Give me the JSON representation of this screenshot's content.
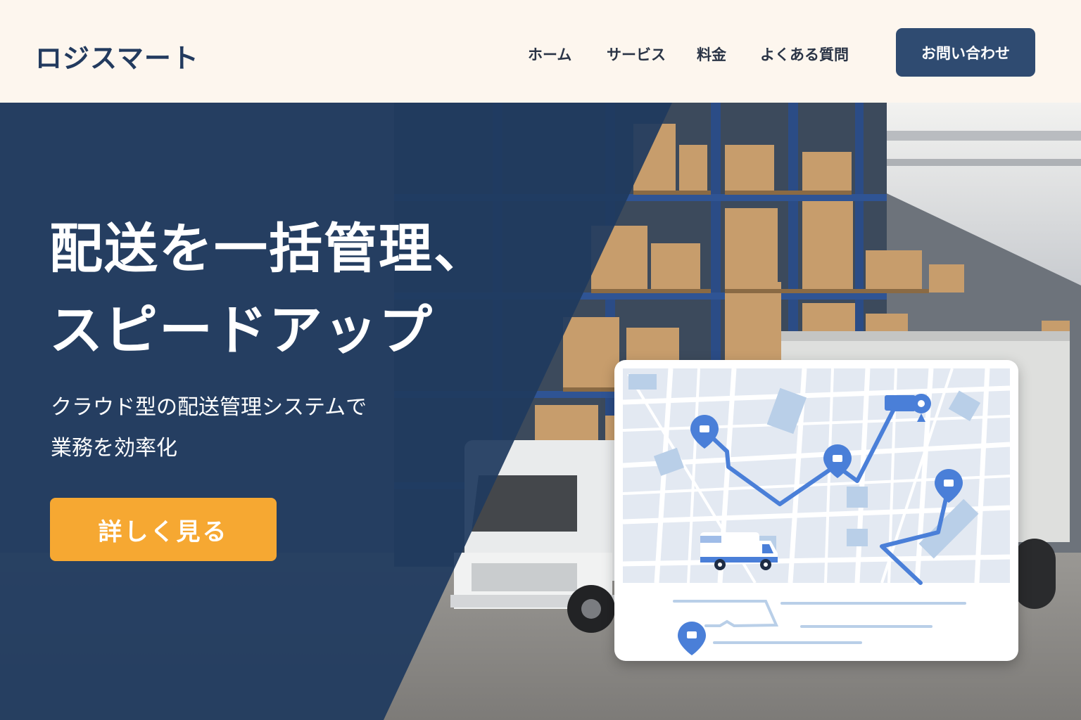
{
  "header": {
    "logo": "ロジスマート",
    "nav": [
      {
        "label": "ホーム"
      },
      {
        "label": "サービス"
      },
      {
        "label": "料金"
      },
      {
        "label": "よくある質問"
      }
    ],
    "contact_label": "お問い合わせ"
  },
  "hero": {
    "headline_line1": "配送を一括管理、",
    "headline_line2": "スピードアップ",
    "sub_line1": "クラウド型の配送管理システムで",
    "sub_line2": "業務を効率化",
    "cta_label": "詳しく見る"
  },
  "colors": {
    "header_bg": "#fdf6ee",
    "brand_navy": "#223a5e",
    "contact_button": "#2f4b71",
    "hero_panel": "#1f3a5f",
    "cta": "#f6a832",
    "map_route": "#4a7fd8"
  }
}
